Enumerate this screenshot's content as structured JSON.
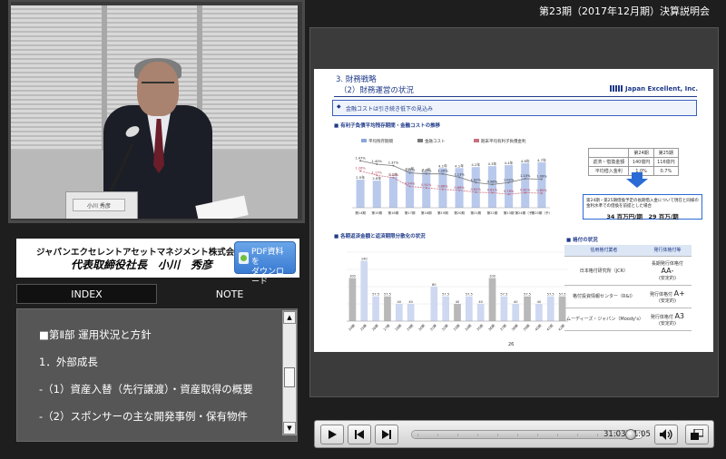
{
  "header": {
    "title": "第23期（2017年12月期）決算説明会"
  },
  "video": {
    "podium_plate": "小川 秀彦"
  },
  "presenter": {
    "company": "ジャパンエクセレントアセットマネジメント株式会社",
    "role_name": "代表取締役社長　小川　秀彦",
    "pdf_button_line1": "PDF資料を",
    "pdf_button_line2": "ダウンロード"
  },
  "tabs": [
    {
      "label": "INDEX",
      "active": true
    },
    {
      "label": "NOTE",
      "active": false
    }
  ],
  "index": {
    "items": [
      "■第Ⅱ部 運用状況と方針",
      "1．外部成長",
      "-（1）資産入替（先行譲渡）・資産取得の概要",
      "-（2）スポンサーの主な開発事例・保有物件"
    ]
  },
  "slide": {
    "title1": "3. 財務戦略",
    "title2": "（2）財務運営の状況",
    "logo": "Japan Excellent, Inc.",
    "bullet": "金融コストは引き続き低下の見込み",
    "section1": "有利子負債平均残存期間・金融コストの推移",
    "section2": "各期返済金額と返済期限分散化の状況",
    "section3": "格付の状況",
    "legend1": [
      "平均残存期間",
      "金融コスト",
      "期末平均有利子負債金利"
    ],
    "table1": {
      "headers": [
        "",
        "第24期",
        "第25期"
      ],
      "rows": [
        [
          "返済・借換金額",
          "140億円",
          "116億円"
        ],
        [
          "平均借入金利",
          "1.0%",
          "0.7%"
        ]
      ]
    },
    "note_text": "第24期・第25期借換予定の長期借入金について現在と同様の金利水準での借換を前提とした場合",
    "note_big": "34 百万円/期　29 百万/期",
    "ratings": [
      {
        "agency": "日本格付研究所（JCR）",
        "type": "長期発行体格付",
        "grade": "AA-",
        "outlook": "安定的"
      },
      {
        "agency": "格付投資情報センター（R&I）",
        "type": "発行体格付",
        "grade": "A+",
        "outlook": "安定的"
      },
      {
        "agency": "ムーディーズ・ジャパン（Moody's）",
        "type": "発行体格付",
        "grade": "A3",
        "outlook": "安定的"
      }
    ],
    "ratings_headers": [
      "信用格付業者",
      "発行体格付等"
    ],
    "page_number": "26"
  },
  "chart_data": [
    {
      "type": "line",
      "title": "有利子負債平均残存期間・金融コストの推移",
      "categories": [
        "第14期",
        "第15期",
        "第16期",
        "第17期",
        "第18期",
        "第19期",
        "第20期",
        "第21期",
        "第22期",
        "第23期",
        "第24期（予）",
        "第25期（予）"
      ],
      "series": [
        {
          "name": "平均残存期間",
          "values": [
            2.9,
            2.8,
            3.2,
            3.8,
            3.7,
            4.1,
            4.1,
            4.2,
            4.3,
            4.4,
            4.6,
            4.7
          ]
        },
        {
          "name": "金融コスト",
          "values": [
            1.47,
            1.4,
            1.37,
            1.22,
            1.2,
            1.2,
            1.13,
            1.02,
            0.98,
            1.02,
            1.1,
            1.09
          ]
        },
        {
          "name": "期末平均有利子負債金利",
          "values": [
            1.26,
            1.17,
            1.12,
            0.94,
            0.91,
            0.88,
            0.86,
            0.82,
            0.81,
            0.78,
            0.81,
            0.8
          ]
        }
      ]
    },
    {
      "type": "bar",
      "title": "各期返済金額と返済期限分散化の状況",
      "categories": [
        "24期",
        "25期",
        "26期",
        "27期",
        "28期",
        "29期",
        "30期",
        "31期",
        "32期",
        "33期",
        "34期",
        "35期",
        "36期",
        "37期",
        "38期",
        "39期",
        "40期",
        "41期",
        "42期"
      ],
      "values": [
        100,
        140,
        57.5,
        57.5,
        40,
        40,
        0,
        80,
        57.5,
        40,
        57.5,
        40,
        100,
        57.5,
        40,
        57.5,
        40,
        57.5,
        57.5
      ]
    }
  ],
  "player": {
    "time": "31:03/31:05",
    "progress": 0.98
  }
}
